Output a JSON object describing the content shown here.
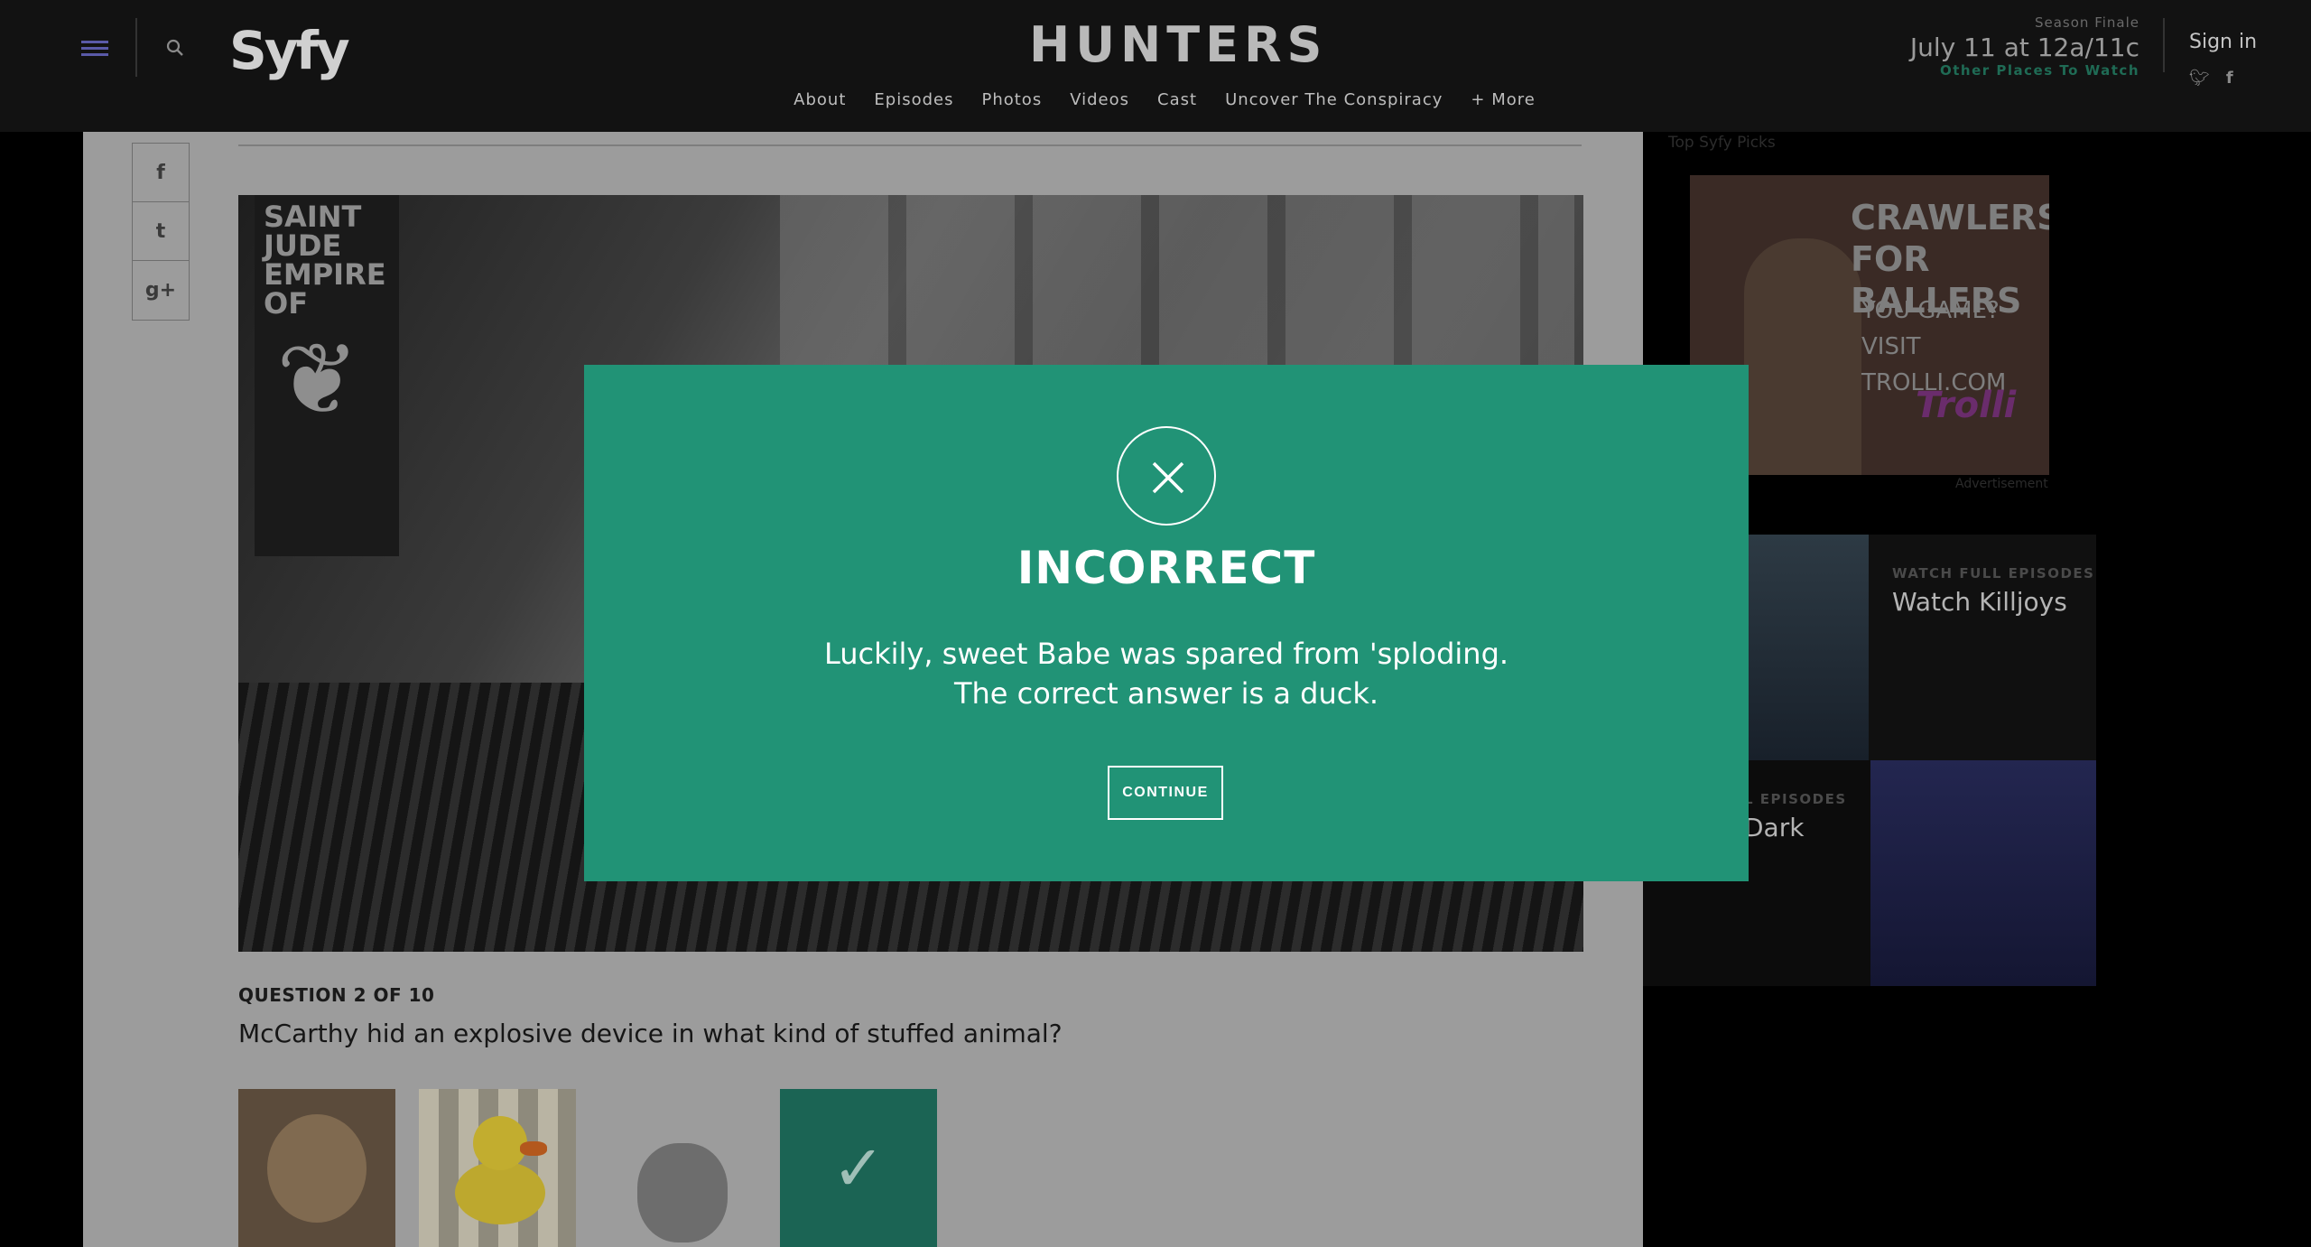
{
  "header": {
    "logo": "Syfy",
    "show_title": "HUNTERS",
    "nav": [
      "About",
      "Episodes",
      "Photos",
      "Videos",
      "Cast",
      "Uncover The Conspiracy",
      "+ More"
    ],
    "season_label": "Season Finale",
    "season_date": "July 11 at 12a/11c",
    "other_places": "Other Places To Watch",
    "sign_in": "Sign in"
  },
  "share": [
    "f",
    "t",
    "g+"
  ],
  "quiz": {
    "question_label": "QUESTION 2 OF 10",
    "question_text": "McCarthy hid an explosive device in what kind of stuffed animal?",
    "answers": [
      "teddy-bear",
      "rubber-duck",
      "bunny",
      "selected"
    ]
  },
  "hero": {
    "poster_text": "SAINT JUDE EMPIRE OF"
  },
  "sidebar": {
    "label": "Top Syfy Picks",
    "ad_headline": "CRAWLERS FOR BALLERS",
    "ad_sub": "YOU GAME? VISIT TROLLI.COM",
    "ad_brand": "Trolli",
    "ad_caption": "Advertisement",
    "card1_eyebrow": "WATCH FULL EPISODES",
    "card1_title": "Watch Killjoys",
    "card2_eyebrow": "L EPISODES",
    "card2_title": "Dark"
  },
  "modal": {
    "title": "INCORRECT",
    "message": "Luckily, sweet Babe was spared from 'sploding. The correct answer is a duck.",
    "continue_label": "CONTINUE"
  }
}
